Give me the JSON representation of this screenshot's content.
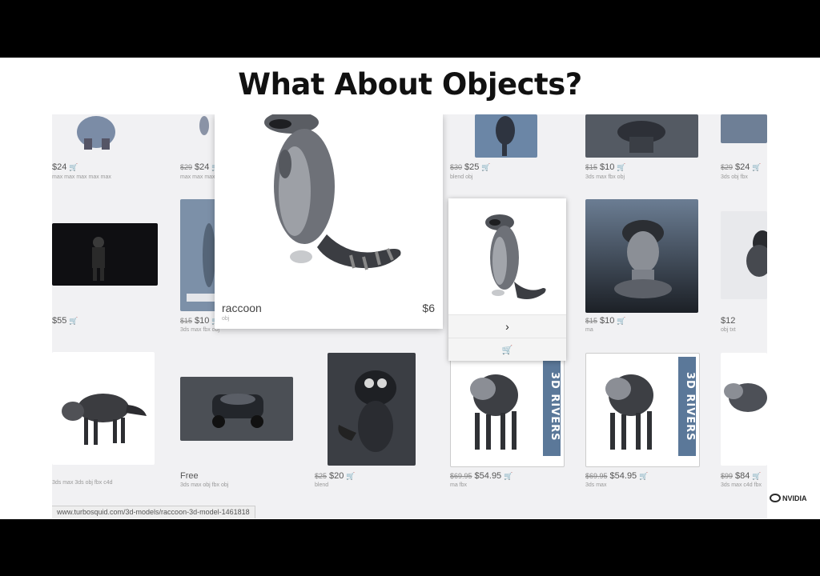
{
  "slide": {
    "title": "What About Objects?"
  },
  "browser": {
    "status_url": "www.turbosquid.com/3d-models/raccoon-3d-model-1461818"
  },
  "grid": {
    "row1": [
      {
        "price": "$24"
      },
      {
        "old_price": "$29",
        "price": "$24"
      },
      {
        "old_price": "$30",
        "price": "$25"
      },
      {
        "old_price": "$15",
        "price": "$10"
      },
      {
        "old_price": "$29",
        "price": "$24"
      }
    ],
    "row2": [
      {
        "price": "$55"
      },
      {
        "old_price": "$15",
        "price": "$10"
      },
      {
        "old_price": "$15",
        "price": "$10"
      },
      {
        "price": "$12"
      }
    ],
    "row3": [
      {
        "price": "Free"
      },
      {
        "old_price": "$25",
        "price": "$20"
      },
      {
        "old_price": "$69.95",
        "price": "$54.95"
      },
      {
        "old_price": "$69.95",
        "price": "$54.95"
      },
      {
        "old_price": "$99",
        "price": "$84"
      }
    ],
    "brand_badge": "3D RIVERS"
  },
  "preview": {
    "name": "raccoon",
    "price": "$6"
  },
  "popup": {
    "next_icon": "chevron-right-icon",
    "cart_icon": "cart-icon"
  },
  "branding": {
    "logo_text": "NVIDIA"
  }
}
